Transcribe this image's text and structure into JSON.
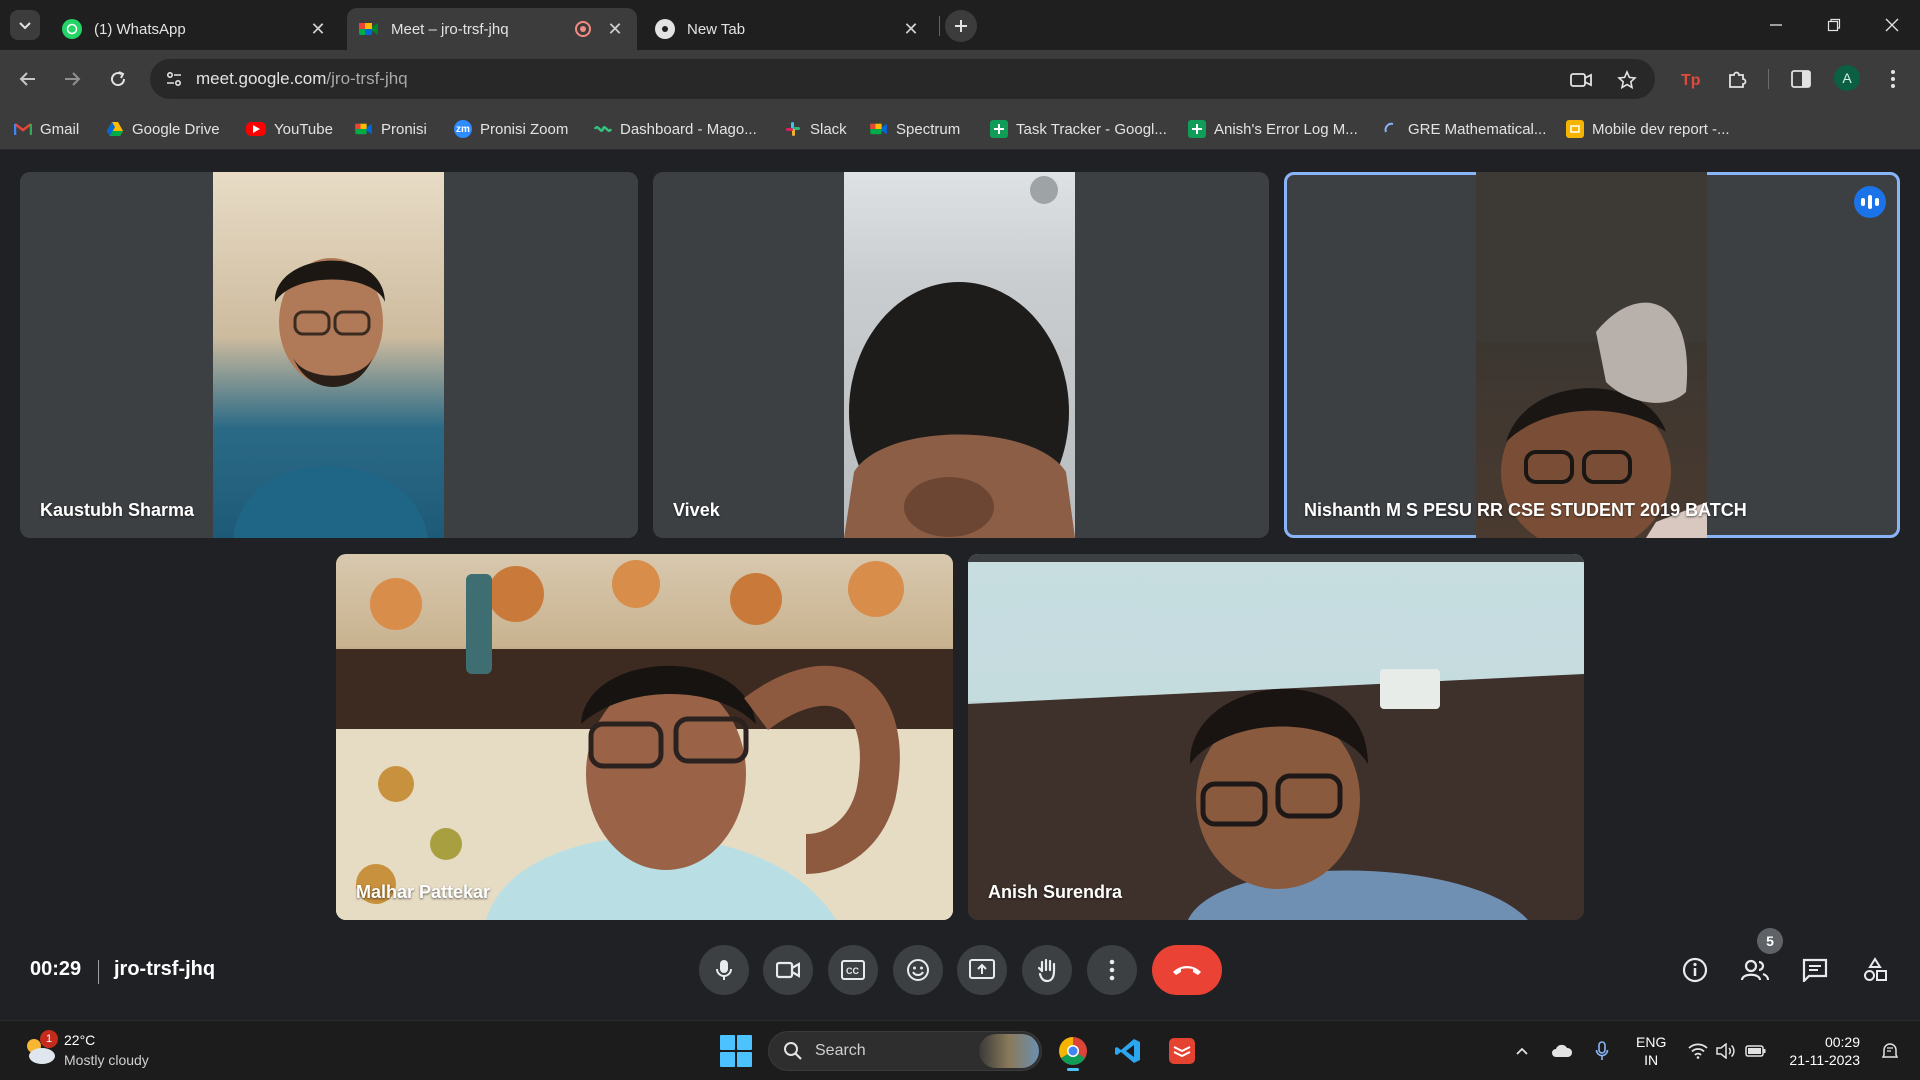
{
  "browser": {
    "tabs": [
      {
        "label": "(1) WhatsApp",
        "favicon": "whatsapp-icon",
        "active": false
      },
      {
        "label": "Meet – jro-trsf-jhq",
        "favicon": "google-meet-icon",
        "active": true,
        "recording": true
      },
      {
        "label": "New Tab",
        "favicon": "chrome-icon",
        "active": false
      }
    ],
    "url_host": "meet.google.com",
    "url_path": "/jro-trsf-jhq",
    "profile_initial": "A",
    "bookmarks": [
      {
        "label": "Gmail",
        "icon": "gmail-icon"
      },
      {
        "label": "Google Drive",
        "icon": "google-drive-icon"
      },
      {
        "label": "YouTube",
        "icon": "youtube-icon"
      },
      {
        "label": "Pronisi",
        "icon": "google-meet-icon"
      },
      {
        "label": "Pronisi Zoom",
        "icon": "zoom-icon"
      },
      {
        "label": "Dashboard - Mago...",
        "icon": "dashboard-icon"
      },
      {
        "label": "Slack",
        "icon": "slack-icon"
      },
      {
        "label": "Spectrum",
        "icon": "google-meet-icon"
      },
      {
        "label": "Task Tracker - Googl...",
        "icon": "google-sheets-icon"
      },
      {
        "label": "Anish's Error Log M...",
        "icon": "google-sheets-icon"
      },
      {
        "label": "GRE Mathematical...",
        "icon": "loading-icon"
      },
      {
        "label": "Mobile dev report -...",
        "icon": "google-slides-icon"
      }
    ]
  },
  "meet": {
    "time": "00:29",
    "code": "jro-trsf-jhq",
    "participants": [
      {
        "name": "Kaustubh Sharma",
        "speaking": false
      },
      {
        "name": "Vivek",
        "speaking": false
      },
      {
        "name": "Nishanth M S PESU RR CSE STUDENT 2019 BATCH",
        "speaking": true
      },
      {
        "name": "Malhar Pattekar",
        "speaking": false
      },
      {
        "name": "Anish Surendra",
        "speaking": false
      }
    ],
    "people_count": "5",
    "colors": {
      "end_call": "#ea4335",
      "speaking_outline": "#8ab4f8",
      "tile_bg": "#3c4043"
    }
  },
  "taskbar": {
    "weather_temp": "22°C",
    "weather_desc": "Mostly cloudy",
    "weather_badge": "1",
    "search_label": "Search",
    "lang_top": "ENG",
    "lang_bottom": "IN",
    "time": "00:29",
    "date": "21-11-2023"
  }
}
